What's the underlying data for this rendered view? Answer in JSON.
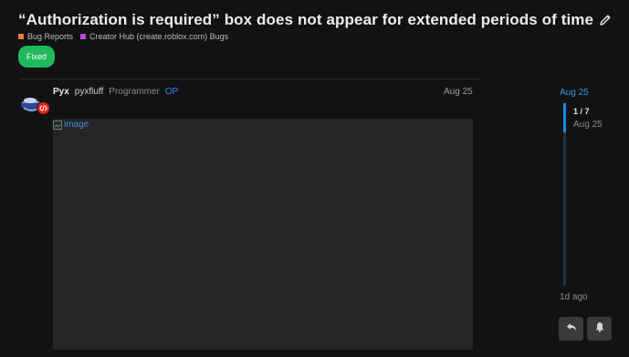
{
  "topic": {
    "title": "“Authorization is required” box does not appear for extended periods of time",
    "categories": [
      {
        "label": "Bug Reports",
        "color": "#e8793b"
      },
      {
        "label": "Creator Hub (create.roblox.com) Bugs",
        "color": "#b94adb"
      }
    ],
    "tag": "Fixed"
  },
  "post": {
    "display_name": "Pyx",
    "username": "pyxfluff",
    "role": "Programmer",
    "op_label": "OP",
    "date": "Aug 25",
    "image_alt": "image"
  },
  "timeline": {
    "start_date": "Aug 25",
    "position": "1 / 7",
    "current_date": "Aug 25",
    "last_activity": "1d ago"
  },
  "icons": {
    "edit": "pencil-icon",
    "reply": "reply-icon",
    "notifications": "bell-icon",
    "badge": "code-icon",
    "broken_image": "broken-image-icon"
  }
}
